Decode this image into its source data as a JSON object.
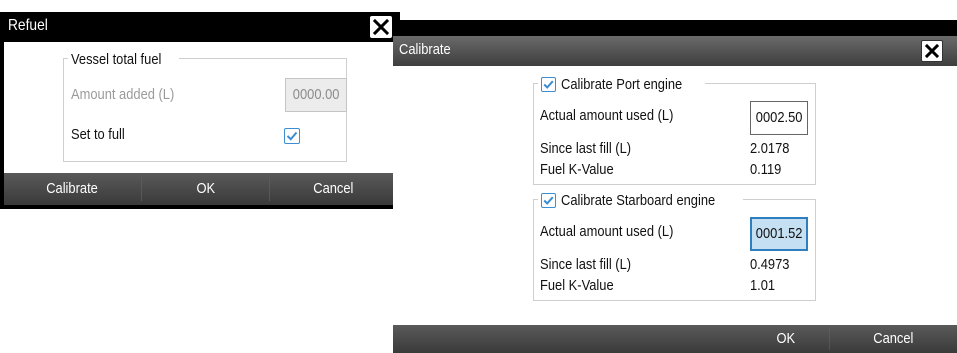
{
  "refuel": {
    "title": "Refuel",
    "group_title": "Vessel total fuel",
    "amount_label": "Amount added (L)",
    "amount_value": "0000.00",
    "full_label": "Set to full",
    "full_checked": true,
    "buttons": {
      "calibrate": "Calibrate",
      "ok": "OK",
      "cancel": "Cancel"
    }
  },
  "calibrate": {
    "title": "Calibrate",
    "port": {
      "group_title": "Calibrate Port engine",
      "checked": true,
      "used_label": "Actual amount used (L)",
      "used_value": "0002.50",
      "since_label": "Since last fill (L)",
      "since_value": "2.0178",
      "kval_label": "Fuel K-Value",
      "kval_value": "0.119"
    },
    "starboard": {
      "group_title": "Calibrate Starboard engine",
      "checked": true,
      "used_label": "Actual amount used (L)",
      "used_value": "0001.52",
      "since_label": "Since last fill (L)",
      "since_value": "0.4973",
      "kval_label": "Fuel K-Value",
      "kval_value": "1.01"
    },
    "buttons": {
      "ok": "OK",
      "cancel": "Cancel"
    }
  },
  "colors": {
    "accent": "#3b8ed2",
    "active_field": "#c5e0f3",
    "titlebar": "#000000"
  },
  "icons": {
    "close": "close-icon",
    "check": "checkmark-icon"
  }
}
